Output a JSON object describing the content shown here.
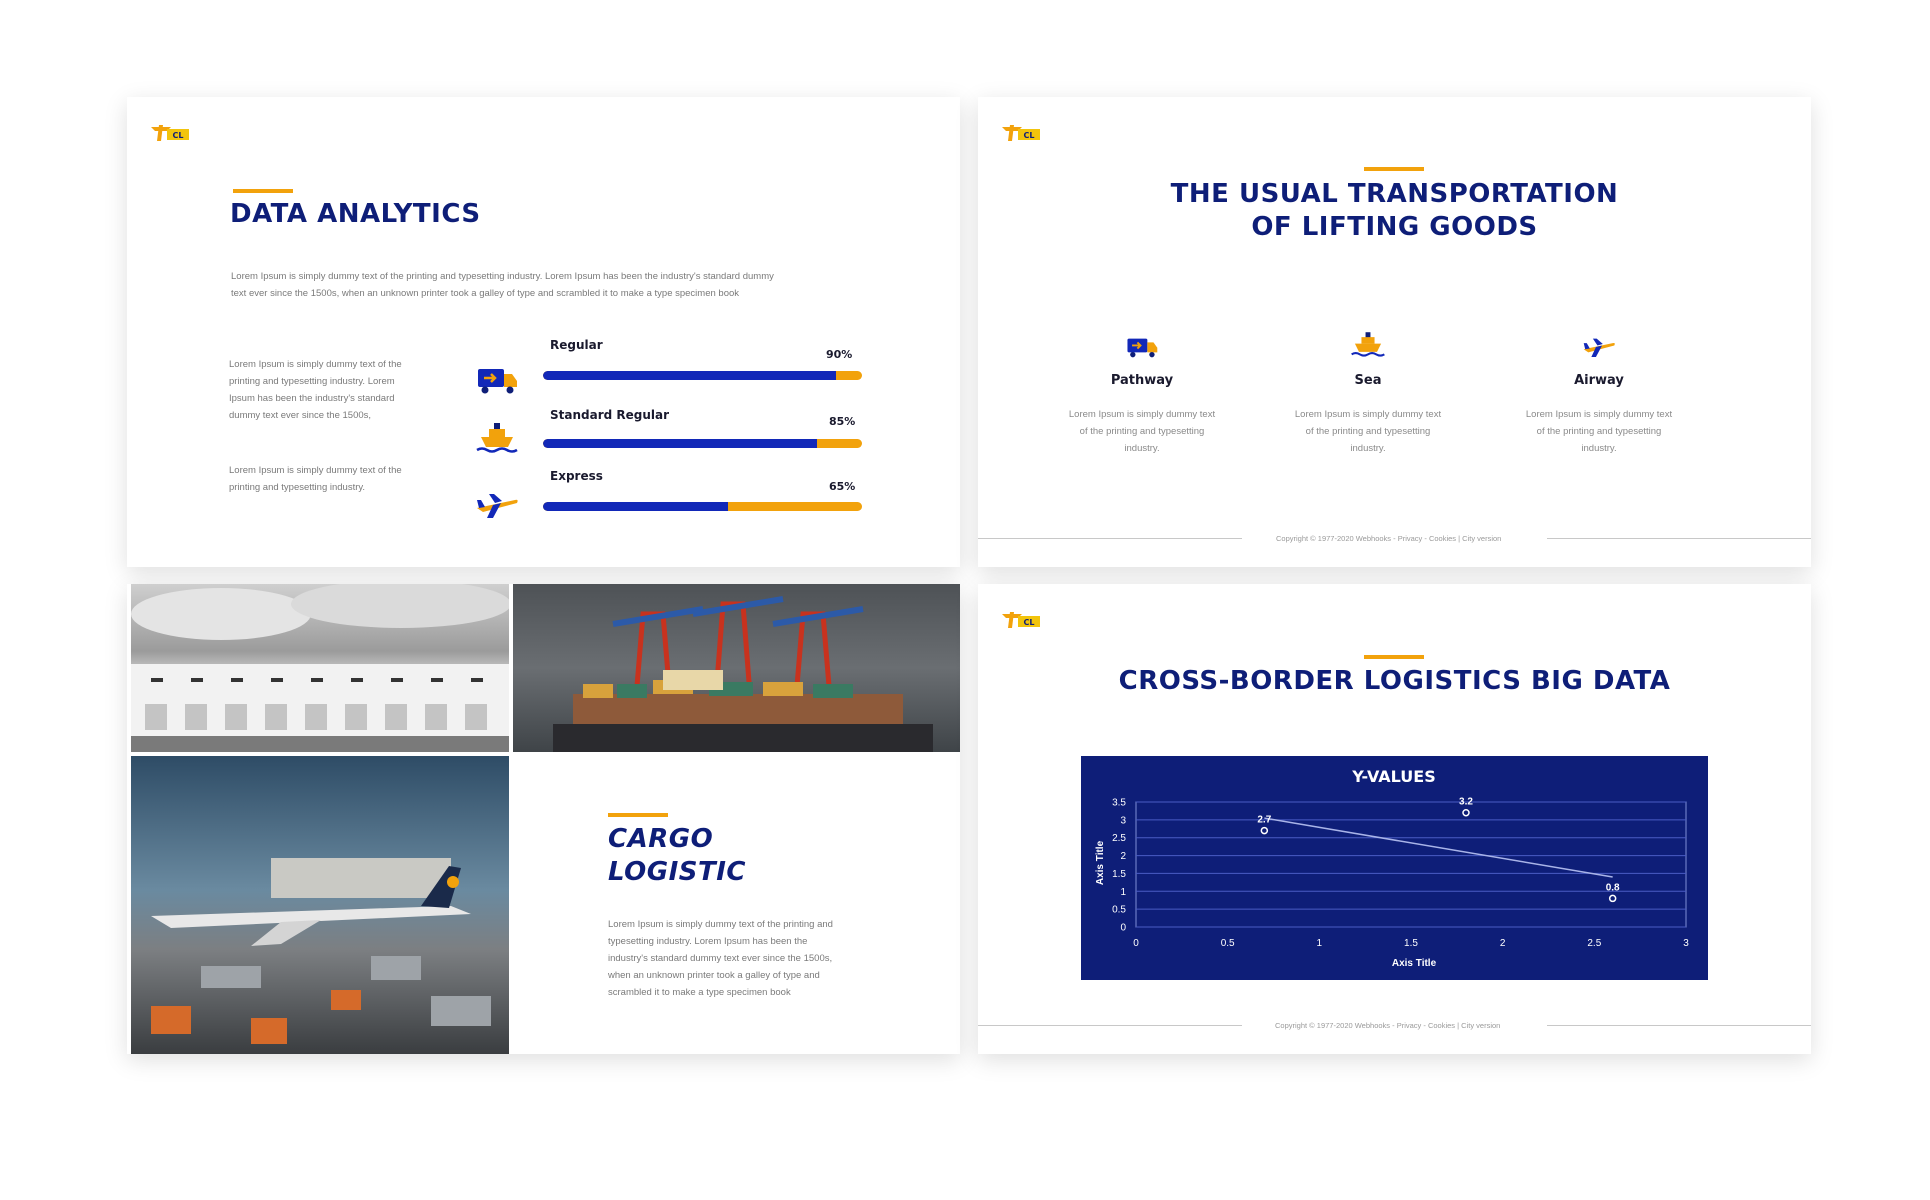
{
  "colors": {
    "navy": "#0e1e78",
    "accent": "#f2a20c",
    "bar_blue": "#1228b8",
    "text_gray": "#7a7a7a"
  },
  "logo": {
    "text": "CL",
    "icon": "truck-logo-icon"
  },
  "slide1": {
    "title": "DATA ANALYTICS",
    "intro_line1": "Lorem Ipsum is simply dummy text of the printing and typesetting industry. Lorem Ipsum has been the industry's standard dummy",
    "intro_line2": "text ever since the 1500s, when an unknown printer took a galley of type and scrambled it to make a type specimen book",
    "side_text1": [
      "Lorem Ipsum is simply dummy text of the",
      "printing and typesetting industry. Lorem",
      "Ipsum has been the industry's standard",
      "dummy text ever since the 1500s,"
    ],
    "side_text2": [
      "Lorem Ipsum is simply dummy text of the",
      "printing and typesetting industry."
    ],
    "bars": [
      {
        "label": "Regular",
        "percent_label": "90%",
        "value": 0.92,
        "icon": "delivery-truck-icon"
      },
      {
        "label": "Standard Regular",
        "percent_label": "85%",
        "value": 0.86,
        "icon": "cargo-ship-icon"
      },
      {
        "label": "Express",
        "percent_label": "65%",
        "value": 0.58,
        "icon": "airplane-icon"
      }
    ]
  },
  "slide2": {
    "title_line1": "THE USUAL TRANSPORTATION",
    "title_line2": "OF LIFTING GOODS",
    "modes": [
      {
        "name": "Pathway",
        "icon": "delivery-truck-icon",
        "text": [
          "Lorem Ipsum is simply dummy text",
          "of the printing and typesetting",
          "industry."
        ]
      },
      {
        "name": "Sea",
        "icon": "cargo-ship-icon",
        "text": [
          "Lorem Ipsum is simply dummy text",
          "of the printing and typesetting",
          "industry."
        ]
      },
      {
        "name": "Airway",
        "icon": "airplane-icon",
        "text": [
          "Lorem Ipsum is simply dummy text",
          "of the printing and typesetting",
          "industry."
        ]
      }
    ],
    "footer": "Copyright © 1977-2020 Webhooks - Privacy - Cookies | City version"
  },
  "slide3": {
    "title_line1": "CARGO",
    "title_line2": "LOGISTIC",
    "body": [
      "Lorem Ipsum is simply dummy text of the printing and",
      "typesetting industry. Lorem Ipsum has been the",
      "industry's standard dummy text ever since the 1500s,",
      "when an unknown printer took a galley of type and",
      "scrambled it to make a type specimen book"
    ],
    "photos": [
      "warehouse-photo",
      "container-port-photo",
      "airport-cargo-photo"
    ]
  },
  "slide4": {
    "title": "CROSS-BORDER LOGISTICS BIG DATA",
    "footer": "Copyright © 1977-2020 Webhooks - Privacy - Cookies | City version"
  },
  "chart_data": {
    "type": "scatter",
    "title": "Y-VALUES",
    "xlabel": "Axis Title",
    "ylabel": "Axis Title",
    "xlim": [
      0,
      3
    ],
    "ylim": [
      0,
      3.5
    ],
    "xticks": [
      "0",
      "0.5",
      "1",
      "1.5",
      "2",
      "2.5",
      "3"
    ],
    "yticks": [
      "0",
      "0.5",
      "1",
      "1.5",
      "2",
      "2.5",
      "3",
      "3.5"
    ],
    "grid": true,
    "points": [
      {
        "x": 0.7,
        "y": 2.7,
        "label": "2.7"
      },
      {
        "x": 1.8,
        "y": 3.2,
        "label": "3.2"
      },
      {
        "x": 2.6,
        "y": 0.8,
        "label": "0.8"
      }
    ],
    "trendline": [
      [
        0.7,
        3.05
      ],
      [
        2.6,
        1.4
      ]
    ]
  }
}
